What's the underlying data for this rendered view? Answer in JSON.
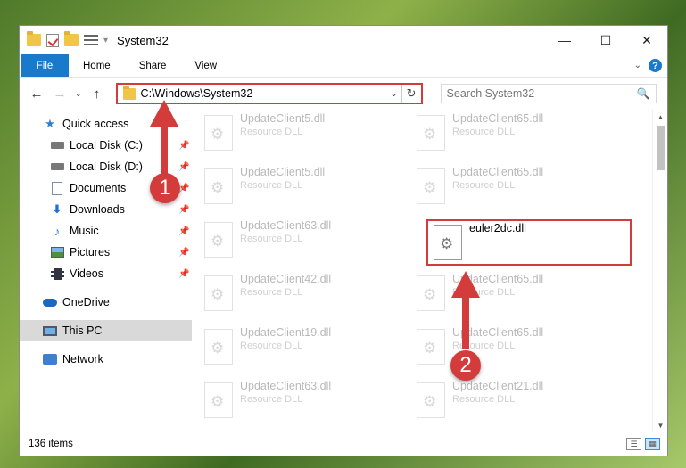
{
  "window": {
    "title": "System32",
    "controls": {
      "minimize": "—",
      "maximize": "☐",
      "close": "✕"
    }
  },
  "quick_access_toolbar": {
    "dropdown": "▾"
  },
  "ribbon": {
    "tabs": [
      "File",
      "Home",
      "Share",
      "View"
    ],
    "expand": "⌄",
    "help": "?"
  },
  "navigation": {
    "back": "←",
    "forward": "→",
    "recent": "⌄",
    "up": "↑",
    "address": "C:\\Windows\\System32",
    "address_dropdown": "⌄",
    "refresh": "↻",
    "search_placeholder": "Search System32",
    "search_icon": "🔍"
  },
  "sidebar": {
    "items": [
      {
        "label": "Quick access",
        "icon": "star-icon",
        "pinned": false
      },
      {
        "label": "Local Disk (C:)",
        "icon": "disk-icon",
        "pinned": true
      },
      {
        "label": "Local Disk (D:)",
        "icon": "disk-icon",
        "pinned": true
      },
      {
        "label": "Documents",
        "icon": "document-icon",
        "pinned": true
      },
      {
        "label": "Downloads",
        "icon": "download-icon",
        "pinned": true
      },
      {
        "label": "Music",
        "icon": "music-icon",
        "pinned": true
      },
      {
        "label": "Pictures",
        "icon": "pictures-icon",
        "pinned": true
      },
      {
        "label": "Videos",
        "icon": "videos-icon",
        "pinned": true
      },
      {
        "label": "OneDrive",
        "icon": "cloud-icon",
        "pinned": false
      },
      {
        "label": "This PC",
        "icon": "computer-icon",
        "pinned": false,
        "selected": true
      },
      {
        "label": "Network",
        "icon": "network-icon",
        "pinned": false
      }
    ],
    "pin_glyph": "📌"
  },
  "files": {
    "left_column": [
      {
        "name": "UpdateClient5.dll",
        "type": "Resource DLL"
      },
      {
        "name": "UpdateClient5.dll",
        "type": "Resource DLL"
      },
      {
        "name": "UpdateClient63.dll",
        "type": "Resource DLL"
      },
      {
        "name": "UpdateClient42.dll",
        "type": "Resource DLL"
      },
      {
        "name": "UpdateClient19.dll",
        "type": "Resource DLL"
      },
      {
        "name": "UpdateClient63.dll",
        "type": "Resource DLL"
      }
    ],
    "right_column": [
      {
        "name": "UpdateClient65.dll",
        "type": "Resource DLL"
      },
      {
        "name": "UpdateClient65.dll",
        "type": "Resource DLL"
      },
      {
        "name": "euler2dc.dll",
        "type": "",
        "highlighted": true
      },
      {
        "name": "UpdateClient65.dll",
        "type": "Resource DLL"
      },
      {
        "name": "UpdateClient65.dll",
        "type": "Resource DLL"
      },
      {
        "name": "UpdateClient21.dll",
        "type": "Resource DLL"
      }
    ]
  },
  "scrollbar": {
    "up": "▲",
    "down": "▼"
  },
  "status": {
    "item_count": "136 items"
  },
  "view_buttons": {
    "details": "☰",
    "tiles": "▦"
  },
  "callouts": {
    "one": "1",
    "two": "2"
  },
  "colors": {
    "accent": "#1979ca",
    "callout": "#d43c3c",
    "selection": "#d9d9d9"
  }
}
